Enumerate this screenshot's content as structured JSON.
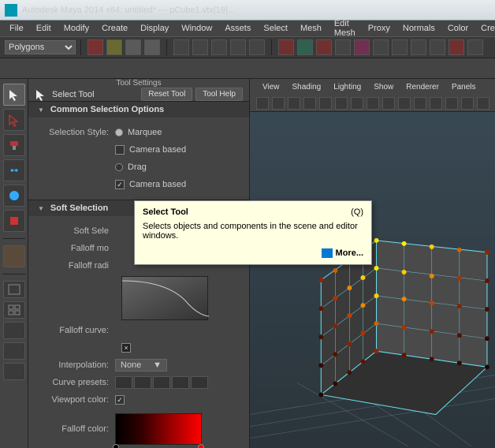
{
  "title": "Autodesk Maya 2014 x64: untitled*   ---   pCube1.vtx[19]...",
  "menus": [
    "File",
    "Edit",
    "Modify",
    "Create",
    "Display",
    "Window",
    "Assets",
    "Select",
    "Mesh",
    "Edit Mesh",
    "Proxy",
    "Normals",
    "Color",
    "Create"
  ],
  "shelf": {
    "mode": "Polygons"
  },
  "settings": {
    "panel_title": "Tool Settings",
    "tool_name": "Select Tool",
    "reset": "Reset Tool",
    "help": "Tool Help"
  },
  "section1": {
    "title": "Common Selection Options",
    "style_label": "Selection Style:",
    "marquee": "Marquee",
    "camera1": "Camera based",
    "drag": "Drag",
    "camera2": "Camera based"
  },
  "section2": {
    "title": "Soft Selection",
    "soft_sel": "Soft Sele",
    "falloff_mode": "Falloff mo",
    "falloff_radius": "Falloff radi",
    "falloff_curve": "Falloff curve:",
    "interpolation": "Interpolation:",
    "interp_value": "None",
    "curve_presets": "Curve presets:",
    "viewport_color": "Viewport color:",
    "falloff_color": "Falloff color:"
  },
  "viewport_menus": [
    "View",
    "Shading",
    "Lighting",
    "Show",
    "Renderer",
    "Panels"
  ],
  "tooltip": {
    "title": "Select Tool",
    "shortcut": "(Q)",
    "body": "Selects objects and components in the scene and editor windows.",
    "more": "More..."
  }
}
